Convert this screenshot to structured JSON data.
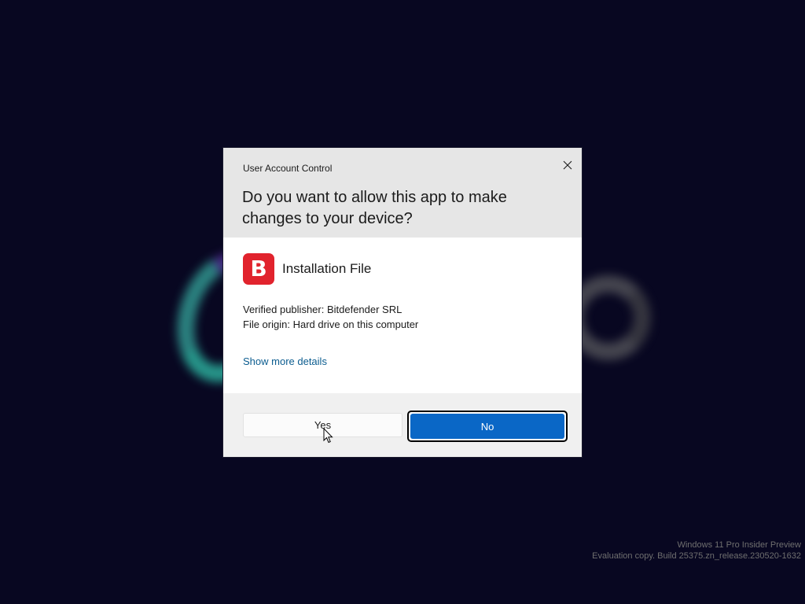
{
  "dialog": {
    "title": "User Account Control",
    "question": "Do you want to allow this app to make changes to your device?",
    "app": {
      "name": "Installation File",
      "icon_letter": "B",
      "icon_color": "#e1232d"
    },
    "publisher": "Verified publisher: Bitdefender SRL",
    "origin": "File origin: Hard drive on this computer",
    "details_link": "Show more details",
    "buttons": {
      "yes": "Yes",
      "no": "No"
    },
    "colors": {
      "primary_button": "#0a67c6",
      "link": "#0b5c8f",
      "header_bg": "#e6e6e6"
    }
  },
  "watermark": {
    "line1": "Windows 11 Pro Insider Preview",
    "line2": "Evaluation copy. Build 25375.zn_release.230520-1632"
  },
  "icons": {
    "close": "close-icon",
    "cursor": "mouse-pointer-icon"
  }
}
